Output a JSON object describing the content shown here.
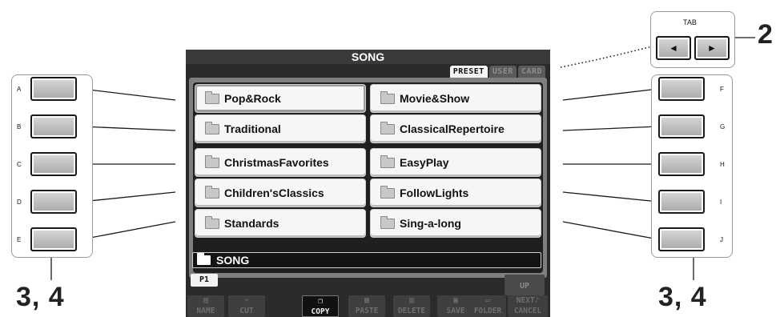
{
  "screen": {
    "title": "SONG",
    "tabs": [
      {
        "label": "PRESET",
        "active": true
      },
      {
        "label": "USER",
        "active": false
      },
      {
        "label": "CARD",
        "active": false
      }
    ],
    "left_items": [
      "Pop&Rock",
      "Traditional",
      "ChristmasFavorites",
      "Children'sClassics",
      "Standards"
    ],
    "right_items": [
      "Movie&Show",
      "ClassicalRepertoire",
      "EasyPlay",
      "FollowLights",
      "Sing-a-long"
    ],
    "selected_item": "Pop&Rock",
    "current_path": "SONG",
    "page_tab": "P1",
    "up_label": "UP",
    "functions": [
      {
        "label": "NAME",
        "icon": "name-icon",
        "active": false
      },
      {
        "label": "CUT",
        "icon": "scissors-icon",
        "active": false
      },
      {
        "label": "COPY",
        "icon": "copy-icon",
        "active": true
      },
      {
        "label": "PASTE",
        "icon": "paste-icon",
        "active": false
      },
      {
        "label": "DELETE",
        "icon": "trash-icon",
        "active": false
      },
      {
        "label": "SAVE",
        "icon": "disk-icon",
        "active": false
      },
      {
        "label": "FOLDER",
        "icon": "folder-icon",
        "active": false
      },
      {
        "label": "NEXT",
        "label2": "CANCEL",
        "icon": "note-icon",
        "active": false
      }
    ]
  },
  "panel": {
    "tab_label": "TAB",
    "tab_left_glyph": "◄",
    "tab_right_glyph": "►",
    "left_buttons": [
      "A",
      "B",
      "C",
      "D",
      "E"
    ],
    "right_buttons": [
      "F",
      "G",
      "H",
      "I",
      "J"
    ]
  },
  "callouts": {
    "tab_step": "2",
    "left_step": "3, 4",
    "right_step": "3, 4"
  },
  "colors": {
    "lcd_background": "#2b2b2b",
    "cell_background": "#f6f6f6",
    "frame_gray": "#9a9a9a"
  }
}
